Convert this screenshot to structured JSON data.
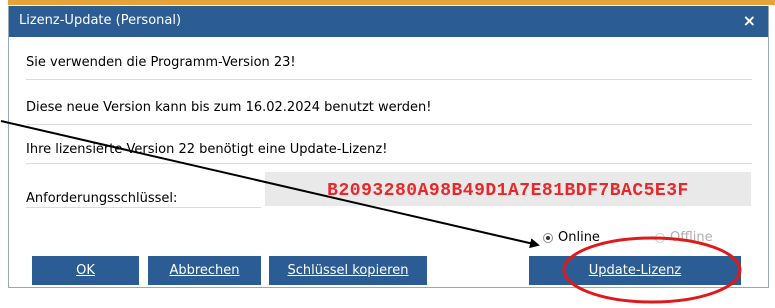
{
  "window": {
    "title": "Lizenz-Update (Personal)",
    "close_glyph": "×"
  },
  "messages": {
    "line1": "Sie verwenden die Programm-Version 23!",
    "line2": "Diese neue Version kann bis zum 16.02.2024 benutzt werden!",
    "line3": "Ihre lizensierte Version 22 benötigt eine Update-Lizenz!"
  },
  "request_key": {
    "label": "Anforderungsschlüssel:",
    "value": "B2093280A98B49D1A7E81BDF7BAC5E3F"
  },
  "mode": {
    "online_label": "Online",
    "offline_label": "Offline",
    "selected": "Online"
  },
  "buttons": {
    "ok": "OK",
    "cancel": "Abbrechen",
    "copy_key": "Schlüssel kopieren",
    "update_license": "Update-Lizenz"
  },
  "colors": {
    "titlebar": "#2b5c93",
    "button": "#2b5c93",
    "key_text": "#e8282a",
    "annotation_circle": "#e01a1a"
  }
}
